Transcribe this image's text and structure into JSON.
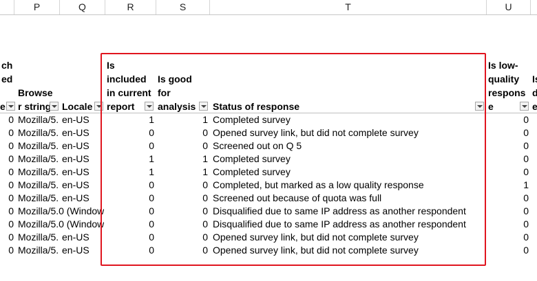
{
  "columns": [
    "P",
    "Q",
    "R",
    "S",
    "T",
    "U"
  ],
  "headers": {
    "o_line1": "ch",
    "o_line2": "ed",
    "o_line3": "e",
    "p_line1": "Browse",
    "p_line2": "r string",
    "q": "Locale",
    "r_line1": "Is",
    "r_line2": "included",
    "r_line3": "in current",
    "r_line4": "report",
    "s_line1": "Is good",
    "s_line2": "for",
    "s_line3": "analysis",
    "t": "Status of response",
    "u_line1": "Is low-",
    "u_line2": "quality",
    "u_line3": "respons",
    "u_line4": "e",
    "v_line1": "Is",
    "v_line2": "d",
    "v_line3": "e"
  },
  "rows": [
    {
      "o": "0",
      "p": "Mozilla/5.",
      "q": "en-US",
      "r": "1",
      "s": "1",
      "t": "Completed survey",
      "u": "0"
    },
    {
      "o": "0",
      "p": "Mozilla/5.",
      "q": "en-US",
      "r": "0",
      "s": "0",
      "t": "Opened survey link, but did not complete survey",
      "u": "0"
    },
    {
      "o": "0",
      "p": "Mozilla/5.",
      "q": "en-US",
      "r": "0",
      "s": "0",
      "t": "Screened out on Q 5",
      "u": "0"
    },
    {
      "o": "0",
      "p": "Mozilla/5.",
      "q": "en-US",
      "r": "1",
      "s": "1",
      "t": "Completed survey",
      "u": "0"
    },
    {
      "o": "0",
      "p": "Mozilla/5.",
      "q": "en-US",
      "r": "1",
      "s": "1",
      "t": "Completed survey",
      "u": "0"
    },
    {
      "o": "0",
      "p": "Mozilla/5.",
      "q": "en-US",
      "r": "0",
      "s": "0",
      "t": "Completed, but marked as a low quality response",
      "u": "1"
    },
    {
      "o": "0",
      "p": "Mozilla/5.",
      "q": "en-US",
      "r": "0",
      "s": "0",
      "t": "Screened out because of quota was full",
      "u": "0"
    },
    {
      "o": "0",
      "p": "Mozilla/5.0 (Window",
      "q": "",
      "r": "0",
      "s": "0",
      "t": "Disqualified due to same IP address as another respondent",
      "u": "0"
    },
    {
      "o": "0",
      "p": "Mozilla/5.0 (Window",
      "q": "",
      "r": "0",
      "s": "0",
      "t": "Disqualified due to same IP address as another respondent",
      "u": "0"
    },
    {
      "o": "0",
      "p": "Mozilla/5.",
      "q": "en-US",
      "r": "0",
      "s": "0",
      "t": "Opened survey link, but did not complete survey",
      "u": "0"
    },
    {
      "o": "0",
      "p": "Mozilla/5.",
      "q": "en-US",
      "r": "0",
      "s": "0",
      "t": "Opened survey link, but did not complete survey",
      "u": "0"
    }
  ],
  "highlight_color": "#e0141e"
}
